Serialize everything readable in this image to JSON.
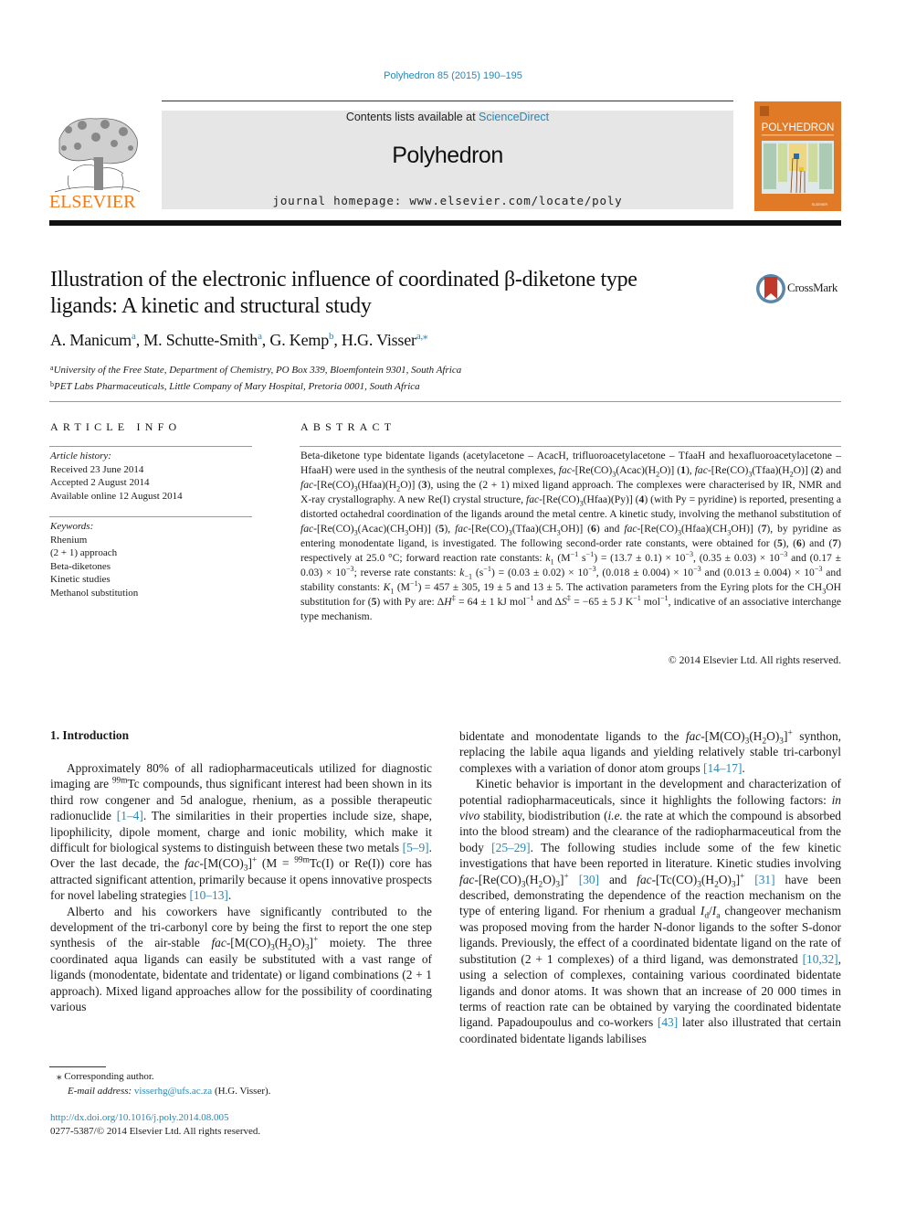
{
  "header": {
    "journal_ref": "Polyhedron 85 (2015) 190–195",
    "contents_prefix": "Contents lists available at ",
    "contents_link": "ScienceDirect",
    "journal_title": "Polyhedron",
    "homepage": "journal homepage: www.elsevier.com/locate/poly",
    "publisher_logo_text": "ELSEVIER",
    "cover_title": "POLYHEDRON",
    "colors": {
      "link": "#2a86b3",
      "elsevier_orange": "#f07a1a",
      "cover_orange": "#e07a26",
      "banner_gray": "#e6e6e6"
    }
  },
  "article": {
    "title_line1": "Illustration of the electronic influence of coordinated β-diketone type",
    "title_line2": "ligands: A kinetic and structural study",
    "crossmark_label": "CrossMark",
    "authors": [
      {
        "name": "A. Manicum",
        "aff": "a"
      },
      {
        "name": "M. Schutte-Smith",
        "aff": "a"
      },
      {
        "name": "G. Kemp",
        "aff": "b"
      },
      {
        "name": "H.G. Visser",
        "aff": "a,⁎"
      }
    ],
    "affiliations": [
      {
        "mark": "a",
        "text": "University of the Free State, Department of Chemistry, PO Box 339, Bloemfontein 9301, South Africa"
      },
      {
        "mark": "b",
        "text": "PET Labs Pharmaceuticals, Little Company of Mary Hospital, Pretoria 0001, South Africa"
      }
    ]
  },
  "article_info": {
    "heading": "ARTICLE INFO",
    "history_label": "Article history:",
    "history": [
      "Received 23 June 2014",
      "Accepted 2 August 2014",
      "Available online 12 August 2014"
    ],
    "keywords_label": "Keywords:",
    "keywords": [
      "Rhenium",
      "(2 + 1) approach",
      "Beta-diketones",
      "Kinetic studies",
      "Methanol substitution"
    ]
  },
  "abstract": {
    "heading": "ABSTRACT",
    "copyright": "© 2014 Elsevier Ltd. All rights reserved."
  },
  "introduction": {
    "heading": "1. Introduction",
    "refs": [
      "[1–4]",
      "[5–9]",
      "[10–13]",
      "[14–17]",
      "[25–29]",
      "[30]",
      "[31]",
      "[10,32]",
      "[43]"
    ]
  },
  "footnotes": {
    "corresponding": "⁎ Corresponding author.",
    "email_label": "E-mail address:",
    "email": "visserhg@ufs.ac.za",
    "email_suffix": " (H.G. Visser).",
    "doi": "http://dx.doi.org/10.1016/j.poly.2014.08.005",
    "issn_copyright": "0277-5387/© 2014 Elsevier Ltd. All rights reserved."
  }
}
